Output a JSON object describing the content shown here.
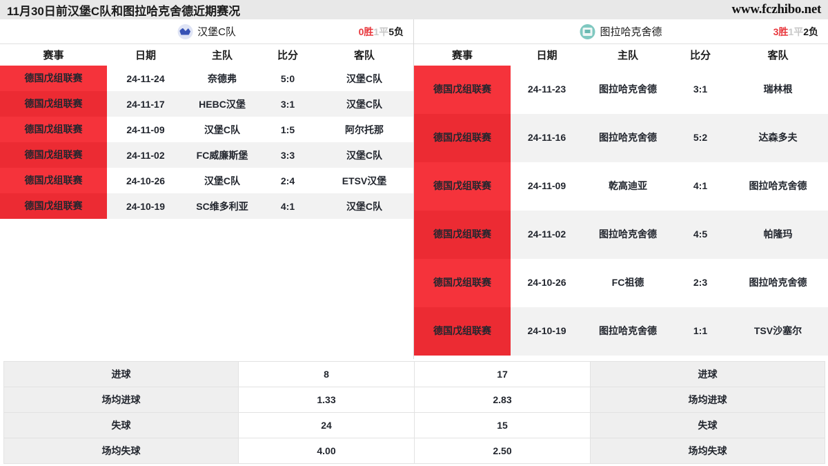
{
  "header": {
    "title": "11月30日前汉堡C队和图拉哈克舍德近期赛况",
    "site": "www.fczhibo.net"
  },
  "left_panel": {
    "team": {
      "name": "汉堡C队",
      "logo": "hamburg-crest-icon"
    },
    "record": {
      "wins": "0胜",
      "draws": "1平",
      "losses": "5负"
    },
    "columns": [
      "赛事",
      "日期",
      "主队",
      "比分",
      "客队"
    ],
    "rows": [
      {
        "league": "德国戊组联赛",
        "date": "24-11-24",
        "home": "奈德弗",
        "score": "5:0",
        "away": "汉堡C队"
      },
      {
        "league": "德国戊组联赛",
        "date": "24-11-17",
        "home": "HEBC汉堡",
        "score": "3:1",
        "away": "汉堡C队"
      },
      {
        "league": "德国戊组联赛",
        "date": "24-11-09",
        "home": "汉堡C队",
        "score": "1:5",
        "away": "阿尔托那"
      },
      {
        "league": "德国戊组联赛",
        "date": "24-11-02",
        "home": "FC威廉斯堡",
        "score": "3:3",
        "away": "汉堡C队"
      },
      {
        "league": "德国戊组联赛",
        "date": "24-10-26",
        "home": "汉堡C队",
        "score": "2:4",
        "away": "ETSV汉堡"
      },
      {
        "league": "德国戊组联赛",
        "date": "24-10-19",
        "home": "SC维多利亚",
        "score": "4:1",
        "away": "汉堡C队"
      }
    ]
  },
  "right_panel": {
    "team": {
      "name": "图拉哈克舍德",
      "logo": "tura-crest-icon"
    },
    "record": {
      "wins": "3胜",
      "draws": "1平",
      "losses": "2负"
    },
    "columns": [
      "赛事",
      "日期",
      "主队",
      "比分",
      "客队"
    ],
    "rows": [
      {
        "league": "德国戊组联赛",
        "date": "24-11-23",
        "home": "图拉哈克舍德",
        "score": "3:1",
        "away": "瑞林根"
      },
      {
        "league": "德国戊组联赛",
        "date": "24-11-16",
        "home": "图拉哈克舍德",
        "score": "5:2",
        "away": "达森多夫"
      },
      {
        "league": "德国戊组联赛",
        "date": "24-11-09",
        "home": "乾高迪亚",
        "score": "4:1",
        "away": "图拉哈克舍德"
      },
      {
        "league": "德国戊组联赛",
        "date": "24-11-02",
        "home": "图拉哈克舍德",
        "score": "4:5",
        "away": "帕隆玛"
      },
      {
        "league": "德国戊组联赛",
        "date": "24-10-26",
        "home": "FC祖德",
        "score": "2:3",
        "away": "图拉哈克舍德"
      },
      {
        "league": "德国戊组联赛",
        "date": "24-10-19",
        "home": "图拉哈克舍德",
        "score": "1:1",
        "away": "TSV沙塞尔"
      }
    ]
  },
  "stats": {
    "rows": [
      {
        "left_label": "进球",
        "left_value": "8",
        "right_value": "17",
        "right_label": "进球"
      },
      {
        "left_label": "场均进球",
        "left_value": "1.33",
        "right_value": "2.83",
        "right_label": "场均进球"
      },
      {
        "left_label": "失球",
        "left_value": "24",
        "right_value": "15",
        "right_label": "失球"
      },
      {
        "left_label": "场均失球",
        "left_value": "4.00",
        "right_value": "2.50",
        "right_label": "场均失球"
      }
    ]
  },
  "colors": {
    "league_badge": "#f5333b",
    "league_badge_alt": "#ec2b33",
    "win_red": "#e8373d",
    "draw_gray": "#c9c9c9",
    "titlebar_bg": "#e8e8e8",
    "row_alt_bg": "#f2f2f2",
    "stat_label_bg": "#efefef"
  }
}
